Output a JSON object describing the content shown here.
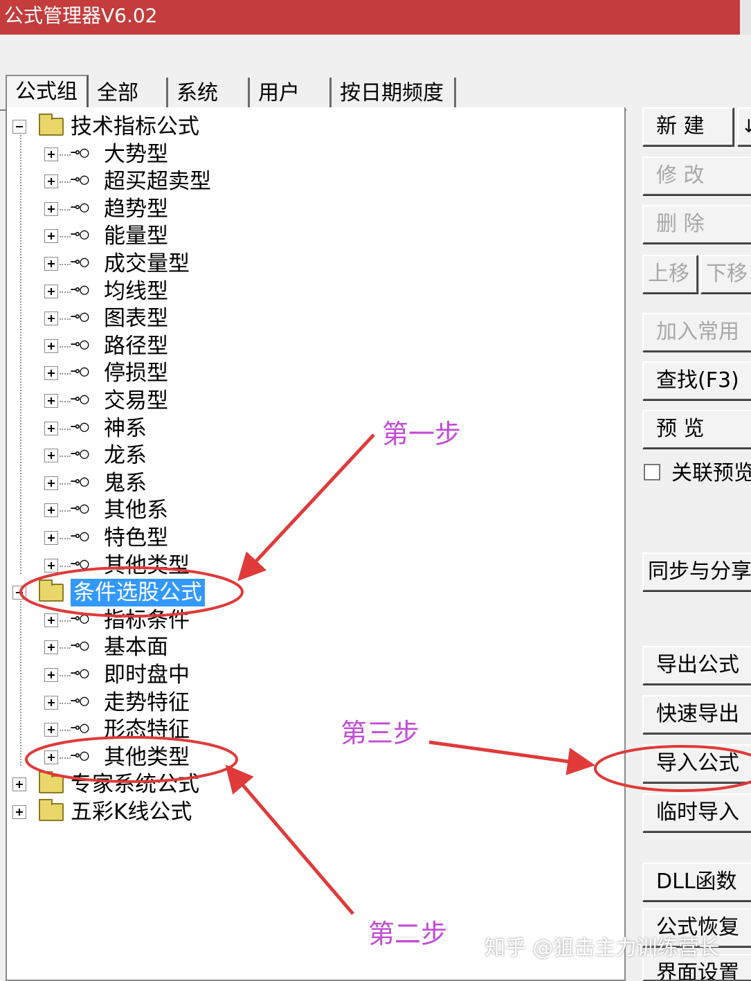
{
  "window": {
    "title": "公式管理器V6.02"
  },
  "tabs": [
    "公式组",
    "全部",
    "系统",
    "用户",
    "按日期频度"
  ],
  "tree": {
    "groups": [
      {
        "label": "技术指标公式",
        "expanded": true,
        "children": [
          "大势型",
          "超买超卖型",
          "趋势型",
          "能量型",
          "成交量型",
          "均线型",
          "图表型",
          "路径型",
          "停损型",
          "交易型",
          "神系",
          "龙系",
          "鬼系",
          "其他系",
          "特色型",
          "其他类型"
        ]
      },
      {
        "label": "条件选股公式",
        "expanded": true,
        "selected": true,
        "children": [
          "指标条件",
          "基本面",
          "即时盘中",
          "走势特征",
          "形态特征",
          "其他类型"
        ]
      },
      {
        "label": "专家系统公式",
        "expanded": false,
        "children": []
      },
      {
        "label": "五彩K线公式",
        "expanded": false,
        "children": []
      }
    ]
  },
  "buttons": {
    "new": "新  建",
    "modify": "修  改",
    "delete": "删  除",
    "move_up": "上移",
    "move_down": "下移",
    "add_common": "加入常用",
    "find": "查找(F3)",
    "preview": "预  览",
    "linked_preview": "关联预览",
    "sync_share": "同步与分享",
    "export_formula": "导出公式",
    "quick_export": "快速导出",
    "import_formula": "导入公式",
    "temp_import": "临时导入",
    "dll_func": "DLL函数",
    "formula_restore": "公式恢复",
    "ui_settings": "界面设置"
  },
  "annotations": {
    "step1": "第一步",
    "step2": "第二步",
    "step3": "第三步"
  },
  "watermark": "知乎 @狙击主力训练营长",
  "colors": {
    "titlebar": "#c43c3c",
    "selection": "#3399ff",
    "annotation_red": "#e03a3a",
    "annotation_text": "#c34bd6"
  }
}
